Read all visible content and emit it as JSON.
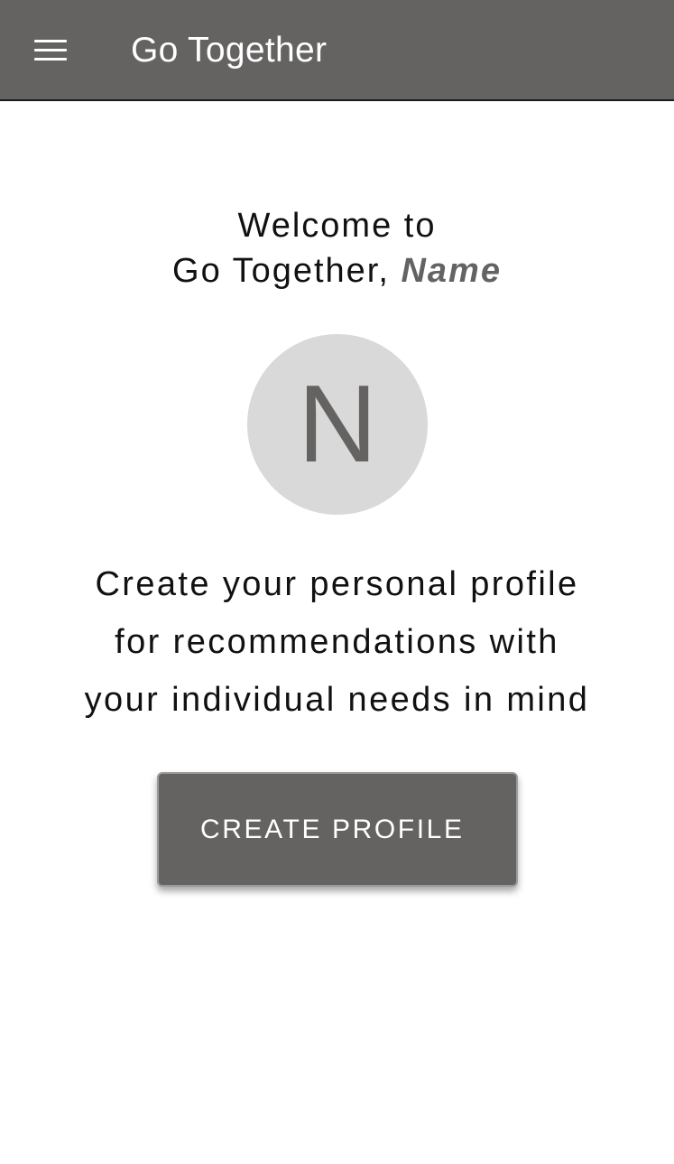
{
  "app_bar": {
    "menu_icon": "hamburger-menu-icon",
    "title": "Go Together",
    "background": "#646362"
  },
  "welcome": {
    "line1": "Welcome to",
    "line2_prefix": "Go Together, ",
    "name": "Name"
  },
  "avatar": {
    "initial": "N",
    "background": "#d9d9d9",
    "text_color": "#646362"
  },
  "promo": {
    "lines": [
      "Create your personal profile",
      "for recommendations with",
      "your individual needs in mind"
    ]
  },
  "cta": {
    "label": "CREATE PROFILE",
    "background": "#646362"
  }
}
